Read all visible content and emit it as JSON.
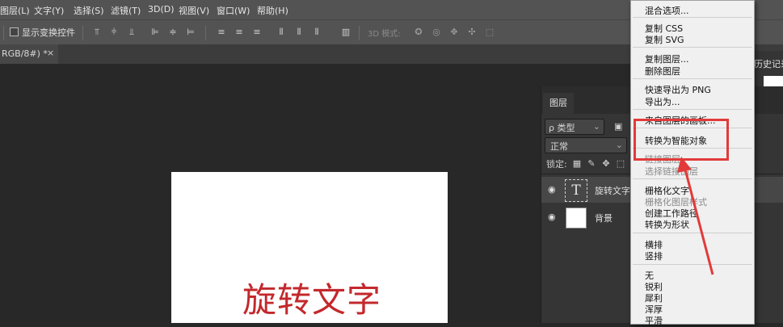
{
  "menubar": {
    "items": [
      "图层(L)",
      "文字(Y)",
      "选择(S)",
      "滤镜(T)",
      "3D(D)",
      "视图(V)",
      "窗口(W)",
      "帮助(H)"
    ]
  },
  "options": {
    "show_transform": "显示变换控件",
    "mode_3d": "3D 模式:"
  },
  "document_tab": {
    "title": "RGB/8#) *",
    "close": "×"
  },
  "canvas": {
    "text": "旋转文字",
    "text_color": "#c3282c"
  },
  "layers_panel": {
    "tab": "图层",
    "filter_kind": "ρ 类型",
    "blend_mode": "正常",
    "lock_label": "锁定:",
    "layers": [
      {
        "name": "旋转文字",
        "type_glyph": "T"
      },
      {
        "name": "背景"
      }
    ]
  },
  "history_panel": {
    "label": "历史记录"
  },
  "context_menu": {
    "items": [
      {
        "label": "混合选项...",
        "enabled": true
      },
      {
        "label": "复制 CSS",
        "enabled": true
      },
      {
        "label": "复制 SVG",
        "enabled": true
      },
      {
        "label": "复制图层...",
        "enabled": true
      },
      {
        "label": "删除图层",
        "enabled": true
      },
      {
        "label": "快速导出为 PNG",
        "enabled": true
      },
      {
        "label": "导出为...",
        "enabled": true
      },
      {
        "label": "来自图层的画板...",
        "enabled": true
      },
      {
        "label": "转换为智能对象",
        "enabled": true
      },
      {
        "label": "链接图层",
        "enabled": false
      },
      {
        "label": "选择链接图层",
        "enabled": false
      },
      {
        "label": "栅格化文字",
        "enabled": true
      },
      {
        "label": "栅格化图层样式",
        "enabled": false
      },
      {
        "label": "创建工作路径",
        "enabled": true
      },
      {
        "label": "转换为形状",
        "enabled": true
      },
      {
        "label": "横排",
        "enabled": true
      },
      {
        "label": "竖排",
        "enabled": true
      },
      {
        "label": "无",
        "enabled": true
      },
      {
        "label": "锐利",
        "enabled": true
      },
      {
        "label": "犀利",
        "enabled": true
      },
      {
        "label": "浑厚",
        "enabled": true
      },
      {
        "label": "平滑",
        "enabled": true
      }
    ]
  },
  "annotation": {
    "color": "#e23a3a"
  }
}
